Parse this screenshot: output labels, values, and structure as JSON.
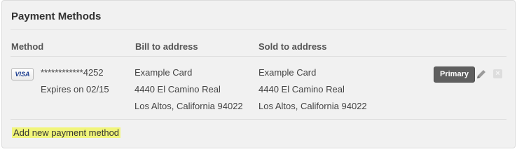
{
  "panel": {
    "title": "Payment Methods",
    "columns": [
      "Method",
      "Bill to address",
      "Sold to address"
    ]
  },
  "method": {
    "card_brand": "VISA",
    "card_number": "************4252",
    "expires": "Expires on 02/15",
    "bill_to": [
      "Example Card",
      "4440 El Camino Real",
      "Los Altos, California 94022"
    ],
    "sold_to": [
      "Example Card",
      "4440 El Camino Real",
      "Los Altos, California 94022"
    ],
    "primary_label": "Primary"
  },
  "icons": {
    "edit": "pencil-icon",
    "delete": "close-icon",
    "card": "visa-card-icon"
  },
  "add_link": "Add new payment method",
  "colors": {
    "highlight": "#f1f57a",
    "primary_badge": "#5f5f5f"
  }
}
